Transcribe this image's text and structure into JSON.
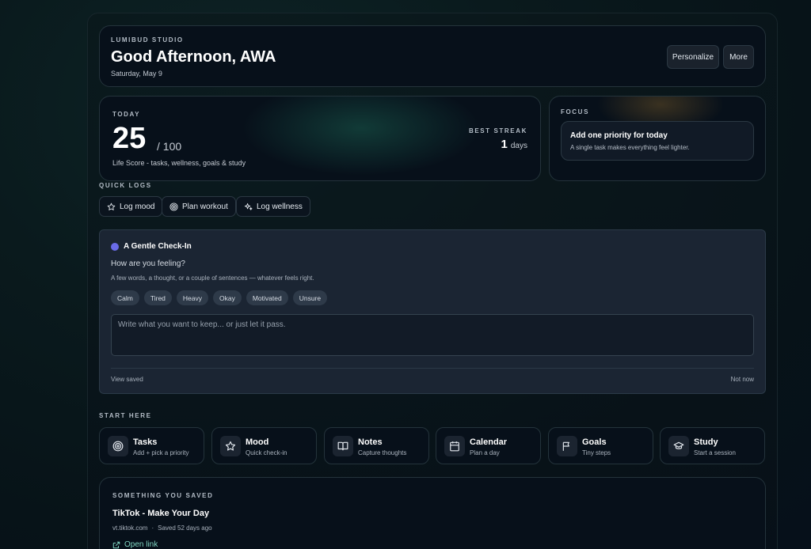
{
  "header": {
    "brand": "LUMIBUD STUDIO",
    "greeting": "Good Afternoon, AWA",
    "date": "Saturday, May 9",
    "personalize_label": "Personalize",
    "more_label": "More"
  },
  "today": {
    "eyebrow": "TODAY",
    "score": "25",
    "score_max": "/ 100",
    "description": "Life Score - tasks, wellness, goals & study",
    "streak_label": "BEST STREAK",
    "streak_value": "1",
    "streak_unit": "days"
  },
  "focus": {
    "eyebrow": "FOCUS",
    "title": "Add one priority for today",
    "subtitle": "A single task makes everything feel lighter."
  },
  "quick_logs": {
    "label": "QUICK LOGS",
    "items": [
      {
        "label": "Log mood",
        "icon": "star-icon"
      },
      {
        "label": "Plan workout",
        "icon": "target-icon"
      },
      {
        "label": "Log wellness",
        "icon": "sparkles-icon"
      }
    ]
  },
  "checkin": {
    "title": "A Gentle Check-In",
    "question": "How are you feeling?",
    "hint": "A few words, a thought, or a couple of sentences — whatever feels right.",
    "chips": [
      "Calm",
      "Tired",
      "Heavy",
      "Okay",
      "Motivated",
      "Unsure"
    ],
    "placeholder": "Write what you want to keep... or just let it pass.",
    "view_saved": "View saved",
    "not_now": "Not now",
    "accent": "#6a6be8"
  },
  "start_here": {
    "label": "START HERE",
    "tiles": [
      {
        "name": "Tasks",
        "sub": "Add + pick a priority",
        "icon": "target-icon"
      },
      {
        "name": "Mood",
        "sub": "Quick check-in",
        "icon": "star-icon"
      },
      {
        "name": "Notes",
        "sub": "Capture thoughts",
        "icon": "book-icon"
      },
      {
        "name": "Calendar",
        "sub": "Plan a day",
        "icon": "calendar-icon"
      },
      {
        "name": "Goals",
        "sub": "Tiny steps",
        "icon": "flag-icon"
      },
      {
        "name": "Study",
        "sub": "Start a session",
        "icon": "graduation-cap-icon"
      }
    ]
  },
  "saved": {
    "eyebrow": "SOMETHING YOU SAVED",
    "title": "TikTok - Make Your Day",
    "domain": "vt.tiktok.com",
    "separator": "·",
    "saved_ago": "Saved 52 days ago",
    "open_label": "Open link",
    "link_color": "#7fd3c0"
  }
}
